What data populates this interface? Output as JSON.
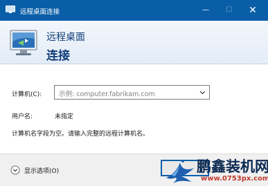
{
  "window": {
    "title": "远程桌面连接",
    "minimize_glyph": "—",
    "maximize_glyph": "☐",
    "close_glyph": "✕"
  },
  "banner": {
    "line1": "远程桌面",
    "line2": "连接",
    "icon": "remote-desktop-monitor-icon"
  },
  "form": {
    "computer_label": "计算机(C):",
    "computer_placeholder": "示例: computer.fabrikam.com",
    "username_label": "用户名:",
    "username_value": "未指定",
    "message": "计算机名字段为空。请输入完整的远程计算机名。"
  },
  "footer": {
    "show_options": "显示选项(O)"
  },
  "watermark": {
    "text": "鹏鑫装机网",
    "url": "www.0753px.com"
  },
  "colors": {
    "titlebar": "#0a5ea8",
    "banner_text": "#0f3c78",
    "watermark_text": "#0c2a52",
    "watermark_url": "#c0392b"
  }
}
